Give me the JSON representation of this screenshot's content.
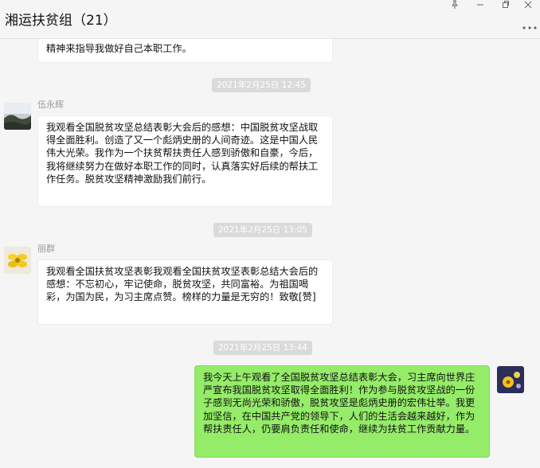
{
  "window": {
    "title": "湘运扶贫组（21）",
    "pin_icon": "pin-icon",
    "minimize_icon": "minimize-icon",
    "restore_icon": "restore-icon",
    "close_icon": "close-icon",
    "more_icon": "more-icon"
  },
  "messages": {
    "m0": {
      "text": "精神来指导我做好自己本职工作。"
    },
    "t1": "2021年2月25日 12:45",
    "m1": {
      "sender": "伍永辉",
      "text": "我观看全国脱贫攻坚总结表彰大会后的感想：中国脱贫攻坚战取得全面胜利。创造了又一个彪炳史册的人间奇迹。这是中国人民伟大光荣。我作为一个扶贫帮扶责任人感到骄傲和自豪，今后，我将继续努力在做好本职工作的同时，认真落实好后续的帮扶工作任务。脱贫攻坚精神激励我们前行。"
    },
    "t2": "2021年2月25日 13:05",
    "m2": {
      "sender": "丽群",
      "text": "我观看全国扶贫攻坚表彰我观看全国扶贫攻坚表彰总结大会后的感想：不忘初心，牢记使命，脱贫攻坚，共同富裕。为祖国喝彩，为国为民，为习主席点赞。榜样的力量是无穷的！致敬[赞]"
    },
    "t3": "2021年2月25日 13:44",
    "m3": {
      "text": "我今天上午观看了全国脱贫攻坚总结表彰大会，习主席向世界庄严宣布我国脱贫攻坚取得全面胜利！作为参与脱贫攻坚战的一份子感到无尚光荣和骄傲，脱贫攻坚是彪炳史册的宏伟壮举。我更加坚信，在中国共产党的领导下，人们的生活会越来越好，作为帮扶责任人，仍要肩负责任和使命，继续为扶贫工作贡献力量。"
    }
  }
}
